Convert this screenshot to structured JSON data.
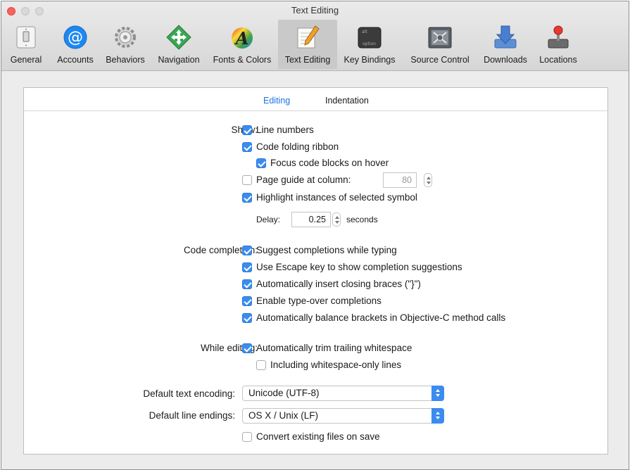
{
  "window": {
    "title": "Text Editing"
  },
  "toolbar": {
    "items": [
      {
        "label": "General",
        "icon": "light-switch-icon"
      },
      {
        "label": "Accounts",
        "icon": "at-sign-icon"
      },
      {
        "label": "Behaviors",
        "icon": "gears-icon"
      },
      {
        "label": "Navigation",
        "icon": "navigation-arrows-icon"
      },
      {
        "label": "Fonts & Colors",
        "icon": "font-letter-icon"
      },
      {
        "label": "Text Editing",
        "icon": "notepad-pencil-icon",
        "selected": true
      },
      {
        "label": "Key Bindings",
        "icon": "option-key-icon"
      },
      {
        "label": "Source Control",
        "icon": "source-control-icon"
      },
      {
        "label": "Downloads",
        "icon": "downloads-arrow-icon"
      },
      {
        "label": "Locations",
        "icon": "joystick-icon"
      }
    ]
  },
  "tabs": [
    {
      "label": "Editing",
      "active": true
    },
    {
      "label": "Indentation",
      "active": false
    }
  ],
  "show": {
    "label": "Show:",
    "line_numbers": {
      "label": "Line numbers",
      "checked": true
    },
    "code_folding": {
      "label": "Code folding ribbon",
      "checked": true
    },
    "focus_blocks": {
      "label": "Focus code blocks on hover",
      "checked": true
    },
    "page_guide": {
      "label": "Page guide at column:",
      "checked": false,
      "value": "80"
    },
    "highlight": {
      "label": "Highlight instances of selected symbol",
      "checked": true
    },
    "delay": {
      "label": "Delay:",
      "value": "0.25",
      "unit": "seconds"
    }
  },
  "code_completion": {
    "label": "Code completion:",
    "items": [
      {
        "label": "Suggest completions while typing",
        "checked": true
      },
      {
        "label": "Use Escape key to show completion suggestions",
        "checked": true
      },
      {
        "label": "Automatically insert closing braces (\"}\")",
        "checked": true
      },
      {
        "label": "Enable type-over completions",
        "checked": true
      },
      {
        "label": "Automatically balance brackets in Objective-C method calls",
        "checked": true
      }
    ]
  },
  "while_editing": {
    "label": "While editing:",
    "trim": {
      "label": "Automatically trim trailing whitespace",
      "checked": true
    },
    "including": {
      "label": "Including whitespace-only lines",
      "checked": false
    }
  },
  "encoding": {
    "label": "Default text encoding:",
    "value": "Unicode (UTF-8)"
  },
  "line_endings": {
    "label": "Default line endings:",
    "value": "OS X / Unix (LF)"
  },
  "convert": {
    "label": "Convert existing files on save",
    "checked": false
  },
  "colors": {
    "accent": "#3b8cf0",
    "close": "#fc605b"
  }
}
